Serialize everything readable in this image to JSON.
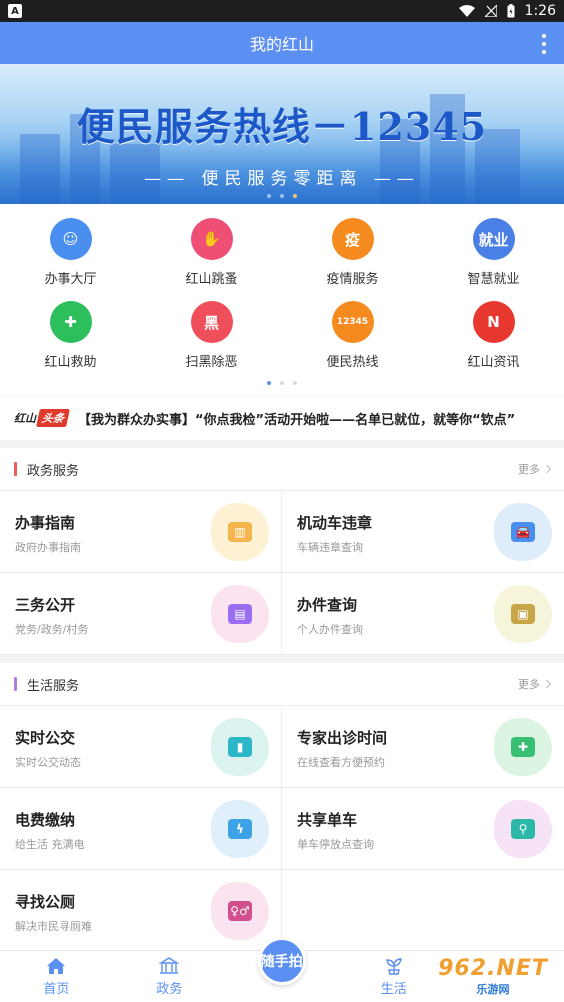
{
  "status_bar": {
    "notification_badge": "A",
    "time": "1:26"
  },
  "app_bar": {
    "title": "我的红山"
  },
  "banner": {
    "headline": "便民服务热线－12345",
    "subline": "—— 便民服务零距离 ——"
  },
  "quick_grid": [
    {
      "label": "办事大厅",
      "icon": "smile-house-icon",
      "color": "#4a8ff0",
      "glyph": "☺"
    },
    {
      "label": "红山跳蚤",
      "icon": "handshake-icon",
      "color": "#ef4f74",
      "glyph": "✋"
    },
    {
      "label": "疫情服务",
      "icon": "epidemic-icon",
      "color": "#f58a1f",
      "glyph": "疫"
    },
    {
      "label": "智慧就业",
      "icon": "employment-icon",
      "color": "#4a7fe6",
      "glyph": "就业"
    },
    {
      "label": "红山救助",
      "icon": "rescue-icon",
      "color": "#2cbf5c",
      "glyph": "✚"
    },
    {
      "label": "扫黑除恶",
      "icon": "anti-crime-icon",
      "color": "#ef4f5a",
      "glyph": "黑"
    },
    {
      "label": "便民热线",
      "icon": "hotline-icon",
      "color": "#f58a1f",
      "glyph": "12345"
    },
    {
      "label": "红山资讯",
      "icon": "news-icon",
      "color": "#e8372e",
      "glyph": "N"
    }
  ],
  "ticker": {
    "logo_a": "红山",
    "logo_b": "头条",
    "headline": "【我为群众办实事】“你点我检”活动开始啦——名单已就位，就等你“钦点”"
  },
  "sections": [
    {
      "title": "政务服务",
      "bar_color": "#ef5a5a",
      "more": "更多",
      "cards": [
        {
          "title": "办事指南",
          "sub": "政府办事指南",
          "icon": "government-building-icon",
          "splash": "#fdf0cf",
          "color": "#f3b64c",
          "glyph": "▥"
        },
        {
          "title": "机动车违章",
          "sub": "车辆违章查询",
          "icon": "car-violation-icon",
          "splash": "#dcebfb",
          "color": "#4a8ff0",
          "glyph": "🚘"
        },
        {
          "title": "三务公开",
          "sub": "党务/政务/村务",
          "icon": "public-affairs-icon",
          "splash": "#fbe0ee",
          "color": "#9a6cf0",
          "glyph": "▤"
        },
        {
          "title": "办件查询",
          "sub": "个人办件查询",
          "icon": "case-query-icon",
          "splash": "#f5f3d6",
          "color": "#c7a64a",
          "glyph": "▣"
        }
      ]
    },
    {
      "title": "生活服务",
      "bar_color": "#a97fe0",
      "more": "更多",
      "cards": [
        {
          "title": "实时公交",
          "sub": "实时公交动态",
          "icon": "bus-icon",
          "splash": "#d7f2f0",
          "color": "#2cb8c8",
          "glyph": "▮"
        },
        {
          "title": "专家出诊时间",
          "sub": "在线查看方便预约",
          "icon": "medical-kit-icon",
          "splash": "#d8f4df",
          "color": "#39bf73",
          "glyph": "✚"
        },
        {
          "title": "电费缴纳",
          "sub": "给生活 充满电",
          "icon": "electricity-icon",
          "splash": "#dbeefb",
          "color": "#3da3e6",
          "glyph": "ϟ"
        },
        {
          "title": "共享单车",
          "sub": "单车停放点查询",
          "icon": "bicycle-icon",
          "splash": "#f5e0f4",
          "color": "#2cb8a8",
          "glyph": "⚲"
        },
        {
          "title": "寻找公厕",
          "sub": "解决市民寻厕难",
          "icon": "restroom-icon",
          "splash": "#fbe0ee",
          "color": "#d04f8c",
          "glyph": "♀♂"
        }
      ]
    }
  ],
  "bottom_nav": {
    "home": "首页",
    "gov": "政务",
    "center": "随手拍",
    "life": "生活"
  },
  "watermark": {
    "brand": "962.NET",
    "site": "乐游网"
  }
}
